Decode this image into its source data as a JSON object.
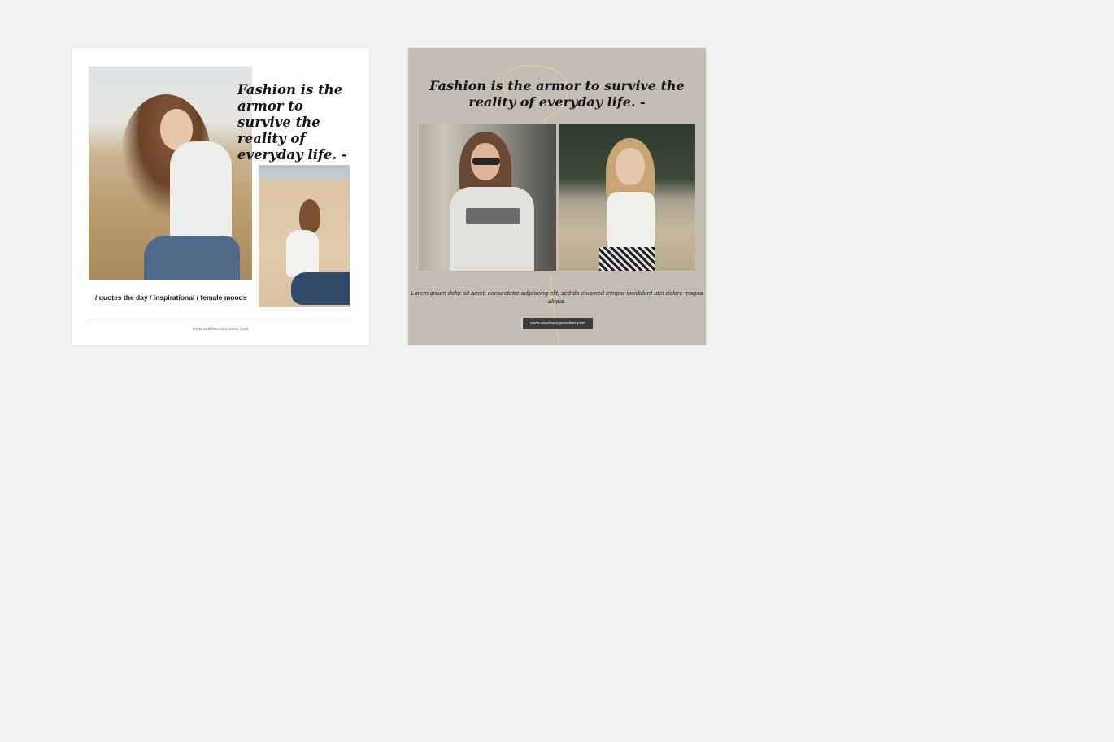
{
  "card1": {
    "quote": "Fashion is the armor to survive the reality of everyday life. -",
    "tags": "/ quotes the day / inspirational / female moods",
    "url": "www.astekacorporation.com"
  },
  "card2": {
    "quote": "Fashion is the armor to survive the reality of everyday life. -",
    "body": "Lorem ipsum dolor sit amet, consectetur adipiscing elit, sed do eiusmod tempor incididunt utet dolore magna aliqua.",
    "url": "www.astekacorporation.com"
  },
  "colors": {
    "background": "#f2f2f2",
    "card1_background": "#ffffff",
    "card2_background": "#c4bdb4",
    "badge_background": "#3b3b3b",
    "accent_line": "#e6d98a"
  }
}
